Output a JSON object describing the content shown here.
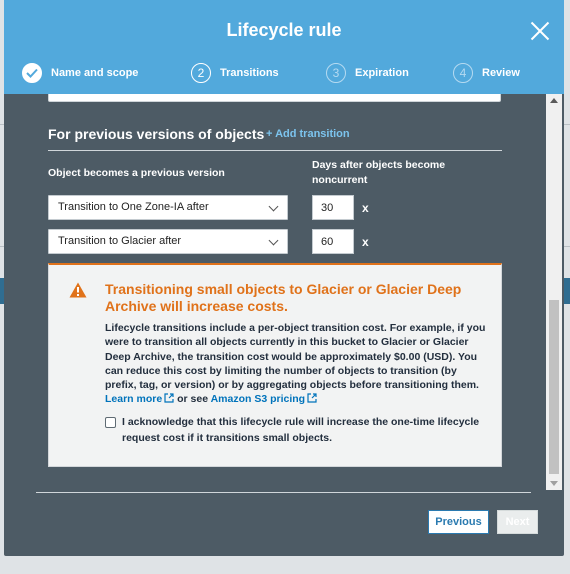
{
  "modal": {
    "title": "Lifecycle rule"
  },
  "steps": [
    {
      "label": "Name and scope",
      "marker": "✓",
      "state": "done"
    },
    {
      "label": "Transitions",
      "marker": "2",
      "state": "active"
    },
    {
      "label": "Expiration",
      "marker": "3",
      "state": "upcoming"
    },
    {
      "label": "Review",
      "marker": "4",
      "state": "upcoming"
    }
  ],
  "section": {
    "title": "For previous versions of objects",
    "add_link": "+ Add transition",
    "col_transition": "Object becomes a previous version",
    "col_days": "Days after objects become noncurrent"
  },
  "transitions": [
    {
      "option": "Transition to One Zone-IA after",
      "days": "30",
      "unit": "x"
    },
    {
      "option": "Transition to Glacier after",
      "days": "60",
      "unit": "x"
    }
  ],
  "warning": {
    "title": "Transitioning small objects to Glacier or Glacier Deep Archive will increase costs.",
    "body": "Lifecycle transitions include a per-object transition cost. For example, if you were to transition all objects currently in this bucket to Glacier or Glacier Deep Archive, the transition cost would be approximately $0.00 (USD). You can reduce this cost by limiting the number of objects to transition (by prefix, tag, or version) or by aggregating objects before transitioning them.",
    "learn_more": "Learn more",
    "or_see": "or see",
    "pricing_link": "Amazon S3 pricing",
    "ack_label": "I acknowledge that this lifecycle rule will increase the one-time lifecycle request cost if it transitions small objects.",
    "ack_checked": false
  },
  "footer": {
    "previous_label": "Previous",
    "next_label": "Next"
  },
  "colors": {
    "header": "#52a9dc",
    "body": "#4d5b65",
    "warning_accent": "#e0721a",
    "link": "#0073bb"
  }
}
